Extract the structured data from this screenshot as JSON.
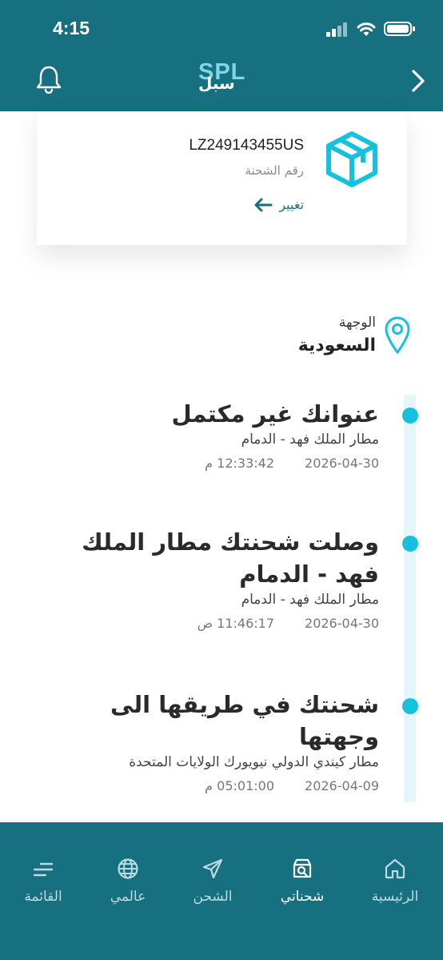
{
  "status_bar": {
    "time": "4:15"
  },
  "header": {
    "logo_text": "SPL",
    "logo_arabic": "سبل"
  },
  "shipment": {
    "tracking_number": "LZ249143455US",
    "tracking_label": "رقم الشحنة",
    "change_label": "تغيير"
  },
  "destination": {
    "label": "الوجهة",
    "value": "السعودية"
  },
  "events": [
    {
      "title": "عنوانك غير مكتمل",
      "location": "مطار الملك فهد - الدمام",
      "date": "2026-04-30",
      "time": "12:33:42 م"
    },
    {
      "title": "وصلت شحنتك مطار الملك فهد - الدمام",
      "location": "مطار الملك فهد - الدمام",
      "date": "2026-04-30",
      "time": "11:46:17 ص"
    },
    {
      "title": "شحنتك في طريقها الى وجهتها",
      "location": "مطار كيندي الدولي نيويورك الولايات المتحدة",
      "date": "2026-04-09",
      "time": "05:01:00 م"
    }
  ],
  "nav": [
    {
      "label": "الرئيسية",
      "icon": "home-icon"
    },
    {
      "label": "شحناتي",
      "icon": "package-search-icon"
    },
    {
      "label": "الشحن",
      "icon": "send-icon"
    },
    {
      "label": "عالمي",
      "icon": "globe-icon"
    },
    {
      "label": "القائمة",
      "icon": "menu-icon"
    }
  ],
  "colors": {
    "primary": "#17707f",
    "accent": "#16c1df",
    "timeline": "#e4f6f9"
  }
}
